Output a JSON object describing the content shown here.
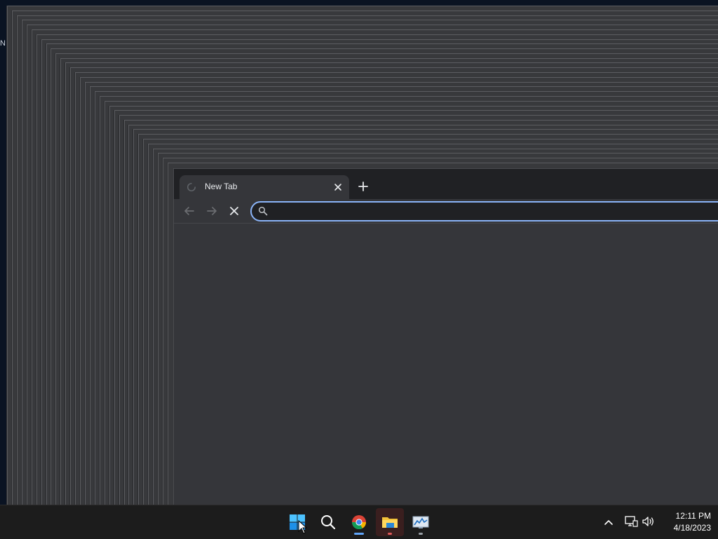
{
  "desktop": {
    "stub_text": "N"
  },
  "browser": {
    "tab": {
      "title": "New Tab",
      "close_icon": "close-icon",
      "loading_icon": "loading-spinner-icon"
    },
    "new_tab_icon": "plus-icon",
    "toolbar": {
      "back_icon": "arrow-left-icon",
      "forward_icon": "arrow-right-icon",
      "stop_icon": "close-icon"
    },
    "omnibox": {
      "value": "",
      "placeholder": "",
      "icon": "search-icon"
    }
  },
  "taskbar": {
    "apps": [
      {
        "name": "Start",
        "icon": "windows-start-icon"
      },
      {
        "name": "Search",
        "icon": "search-icon"
      },
      {
        "name": "Google Chrome",
        "icon": "chrome-icon",
        "active": true
      },
      {
        "name": "File Explorer",
        "icon": "folder-icon",
        "running": true
      },
      {
        "name": "Resource Monitor",
        "icon": "monitor-chart-icon",
        "running": true
      }
    ],
    "tray": {
      "chevron_icon": "chevron-up-icon",
      "network_icon": "network-icon",
      "volume_icon": "volume-icon"
    },
    "clock": {
      "time": "12:11 PM",
      "date": "4/18/2023"
    }
  },
  "colors": {
    "tab_strip": "#202124",
    "toolbar": "#35363a",
    "omnibox_focus": "#8ab4f8",
    "taskbar": "#1c1c1c",
    "chrome_indicator": "#60a5fa",
    "explorer_indicator": "#e05a5a"
  }
}
